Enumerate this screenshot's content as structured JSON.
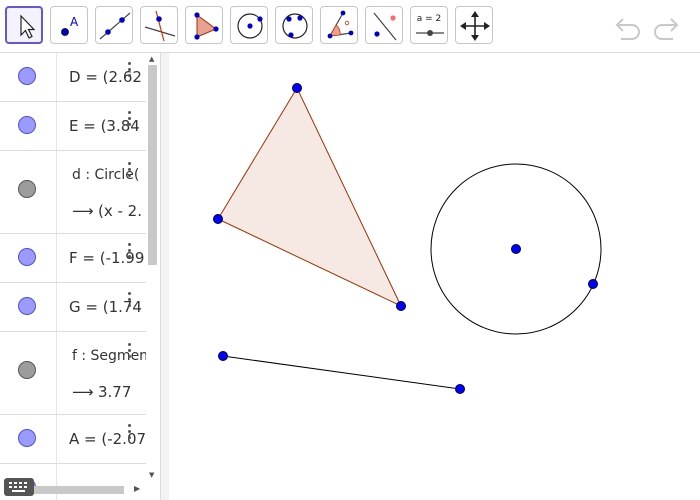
{
  "toolbar": {
    "tools": [
      {
        "name": "move-tool"
      },
      {
        "name": "point-tool",
        "glyph": "A"
      },
      {
        "name": "line-tool"
      },
      {
        "name": "perpendicular-line-tool"
      },
      {
        "name": "polygon-tool"
      },
      {
        "name": "circle-center-point-tool"
      },
      {
        "name": "circle-three-points-tool"
      },
      {
        "name": "angle-tool"
      },
      {
        "name": "reflect-tool"
      },
      {
        "name": "slider-tool",
        "label": "a = 2"
      },
      {
        "name": "move-graphics-view-tool"
      }
    ]
  },
  "algebra": {
    "items": [
      {
        "label": "D = (2.62",
        "visible": true
      },
      {
        "label": "E = (3.84",
        "visible": true
      },
      {
        "label": "d : Circle(",
        "output": "(x - 2.",
        "visible": false
      },
      {
        "label": "F = (-1.99",
        "visible": true
      },
      {
        "label": "G = (1.74",
        "visible": true
      },
      {
        "label": "f : Segmen",
        "output": "3.77",
        "visible": false
      },
      {
        "label": "A = (-2.07",
        "visible": true
      }
    ]
  },
  "colors": {
    "accent": "#6557d2",
    "point": "#0000ff",
    "polygon_fill": "#f5e6e0",
    "polygon_stroke": "#993300"
  }
}
